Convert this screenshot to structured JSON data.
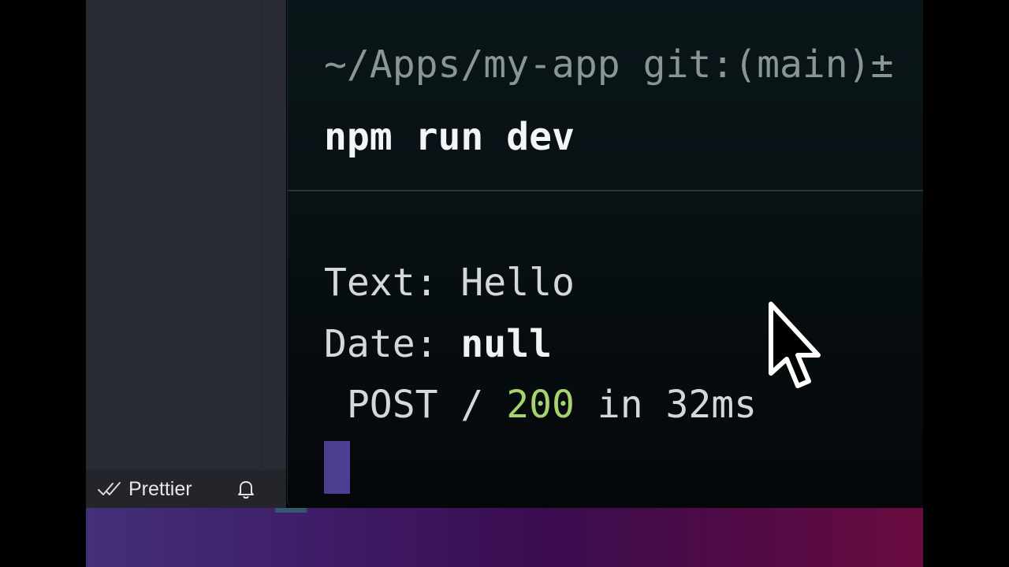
{
  "terminal": {
    "prompt": "~/Apps/my-app git:(main)±",
    "command": "npm run dev",
    "output": {
      "text_label": "Text: ",
      "text_value": "Hello",
      "date_label": "Date: ",
      "date_value": "null",
      "request_method": " POST / ",
      "status_code": "200",
      "timing": " in 32ms"
    }
  },
  "statusbar": {
    "formatter_label": "Prettier",
    "formatter_icon": "double-check-icon",
    "notification_icon": "bell-icon"
  },
  "colors": {
    "status_ok": "#a5d46e",
    "cursor": "#4d3e91",
    "terminal_bg": "#081114"
  }
}
